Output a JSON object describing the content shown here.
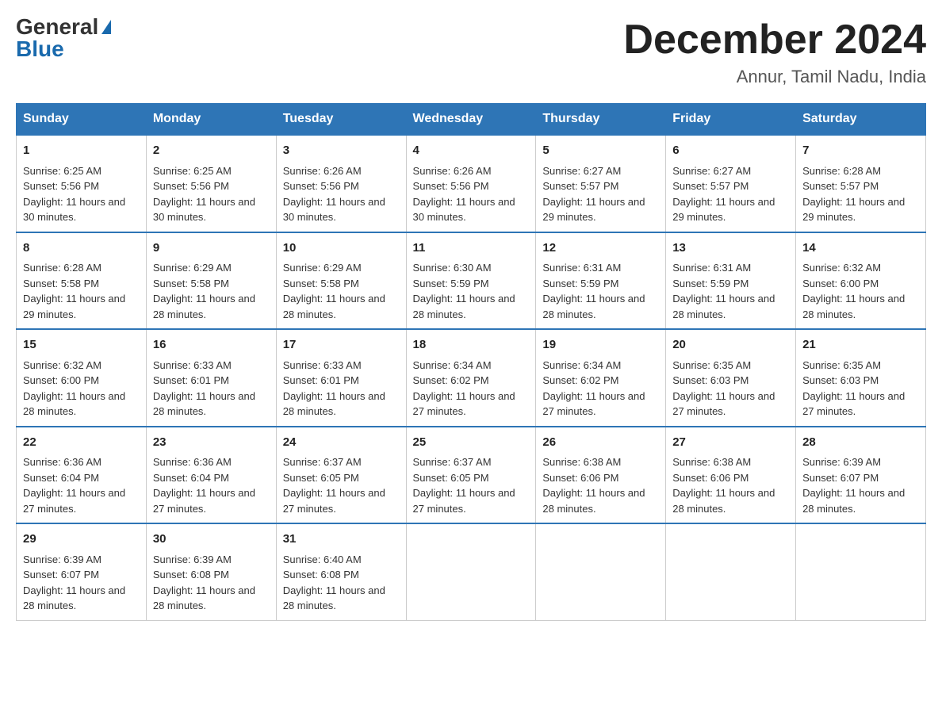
{
  "header": {
    "logo_general": "General",
    "logo_blue": "Blue",
    "month": "December 2024",
    "location": "Annur, Tamil Nadu, India"
  },
  "days_of_week": [
    "Sunday",
    "Monday",
    "Tuesday",
    "Wednesday",
    "Thursday",
    "Friday",
    "Saturday"
  ],
  "weeks": [
    [
      {
        "day": 1,
        "sunrise": "6:25 AM",
        "sunset": "5:56 PM",
        "daylight": "11 hours and 30 minutes."
      },
      {
        "day": 2,
        "sunrise": "6:25 AM",
        "sunset": "5:56 PM",
        "daylight": "11 hours and 30 minutes."
      },
      {
        "day": 3,
        "sunrise": "6:26 AM",
        "sunset": "5:56 PM",
        "daylight": "11 hours and 30 minutes."
      },
      {
        "day": 4,
        "sunrise": "6:26 AM",
        "sunset": "5:56 PM",
        "daylight": "11 hours and 30 minutes."
      },
      {
        "day": 5,
        "sunrise": "6:27 AM",
        "sunset": "5:57 PM",
        "daylight": "11 hours and 29 minutes."
      },
      {
        "day": 6,
        "sunrise": "6:27 AM",
        "sunset": "5:57 PM",
        "daylight": "11 hours and 29 minutes."
      },
      {
        "day": 7,
        "sunrise": "6:28 AM",
        "sunset": "5:57 PM",
        "daylight": "11 hours and 29 minutes."
      }
    ],
    [
      {
        "day": 8,
        "sunrise": "6:28 AM",
        "sunset": "5:58 PM",
        "daylight": "11 hours and 29 minutes."
      },
      {
        "day": 9,
        "sunrise": "6:29 AM",
        "sunset": "5:58 PM",
        "daylight": "11 hours and 28 minutes."
      },
      {
        "day": 10,
        "sunrise": "6:29 AM",
        "sunset": "5:58 PM",
        "daylight": "11 hours and 28 minutes."
      },
      {
        "day": 11,
        "sunrise": "6:30 AM",
        "sunset": "5:59 PM",
        "daylight": "11 hours and 28 minutes."
      },
      {
        "day": 12,
        "sunrise": "6:31 AM",
        "sunset": "5:59 PM",
        "daylight": "11 hours and 28 minutes."
      },
      {
        "day": 13,
        "sunrise": "6:31 AM",
        "sunset": "5:59 PM",
        "daylight": "11 hours and 28 minutes."
      },
      {
        "day": 14,
        "sunrise": "6:32 AM",
        "sunset": "6:00 PM",
        "daylight": "11 hours and 28 minutes."
      }
    ],
    [
      {
        "day": 15,
        "sunrise": "6:32 AM",
        "sunset": "6:00 PM",
        "daylight": "11 hours and 28 minutes."
      },
      {
        "day": 16,
        "sunrise": "6:33 AM",
        "sunset": "6:01 PM",
        "daylight": "11 hours and 28 minutes."
      },
      {
        "day": 17,
        "sunrise": "6:33 AM",
        "sunset": "6:01 PM",
        "daylight": "11 hours and 28 minutes."
      },
      {
        "day": 18,
        "sunrise": "6:34 AM",
        "sunset": "6:02 PM",
        "daylight": "11 hours and 27 minutes."
      },
      {
        "day": 19,
        "sunrise": "6:34 AM",
        "sunset": "6:02 PM",
        "daylight": "11 hours and 27 minutes."
      },
      {
        "day": 20,
        "sunrise": "6:35 AM",
        "sunset": "6:03 PM",
        "daylight": "11 hours and 27 minutes."
      },
      {
        "day": 21,
        "sunrise": "6:35 AM",
        "sunset": "6:03 PM",
        "daylight": "11 hours and 27 minutes."
      }
    ],
    [
      {
        "day": 22,
        "sunrise": "6:36 AM",
        "sunset": "6:04 PM",
        "daylight": "11 hours and 27 minutes."
      },
      {
        "day": 23,
        "sunrise": "6:36 AM",
        "sunset": "6:04 PM",
        "daylight": "11 hours and 27 minutes."
      },
      {
        "day": 24,
        "sunrise": "6:37 AM",
        "sunset": "6:05 PM",
        "daylight": "11 hours and 27 minutes."
      },
      {
        "day": 25,
        "sunrise": "6:37 AM",
        "sunset": "6:05 PM",
        "daylight": "11 hours and 27 minutes."
      },
      {
        "day": 26,
        "sunrise": "6:38 AM",
        "sunset": "6:06 PM",
        "daylight": "11 hours and 28 minutes."
      },
      {
        "day": 27,
        "sunrise": "6:38 AM",
        "sunset": "6:06 PM",
        "daylight": "11 hours and 28 minutes."
      },
      {
        "day": 28,
        "sunrise": "6:39 AM",
        "sunset": "6:07 PM",
        "daylight": "11 hours and 28 minutes."
      }
    ],
    [
      {
        "day": 29,
        "sunrise": "6:39 AM",
        "sunset": "6:07 PM",
        "daylight": "11 hours and 28 minutes."
      },
      {
        "day": 30,
        "sunrise": "6:39 AM",
        "sunset": "6:08 PM",
        "daylight": "11 hours and 28 minutes."
      },
      {
        "day": 31,
        "sunrise": "6:40 AM",
        "sunset": "6:08 PM",
        "daylight": "11 hours and 28 minutes."
      },
      null,
      null,
      null,
      null
    ]
  ],
  "labels": {
    "sunrise": "Sunrise:",
    "sunset": "Sunset:",
    "daylight": "Daylight:"
  }
}
